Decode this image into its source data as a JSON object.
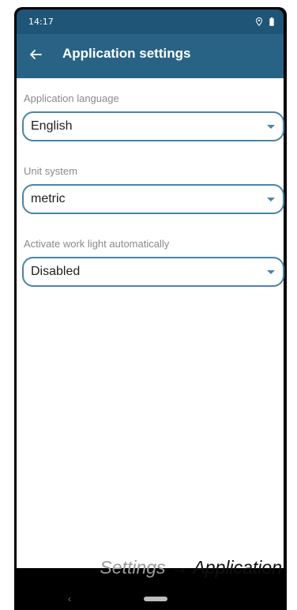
{
  "status_bar": {
    "time": "14:17",
    "icons": [
      "location-icon",
      "battery-icon"
    ]
  },
  "app_bar": {
    "back_icon": "back-arrow-icon",
    "title": "Application settings"
  },
  "settings": [
    {
      "label": "Application language",
      "value": "English"
    },
    {
      "label": "Unit system",
      "value": "metric"
    },
    {
      "label": "Activate work light automatically",
      "value": "Disabled"
    }
  ],
  "caption": {
    "prefix": "Settings",
    "arrow": "→",
    "suffix": "Application"
  },
  "nav_bar": {
    "back_glyph": "‹",
    "home_icon": "home-pill-icon"
  },
  "colors": {
    "status_bar": "#1f5576",
    "app_bar": "#286386",
    "accent": "#4c84a5",
    "label": "#8a8a8a"
  }
}
